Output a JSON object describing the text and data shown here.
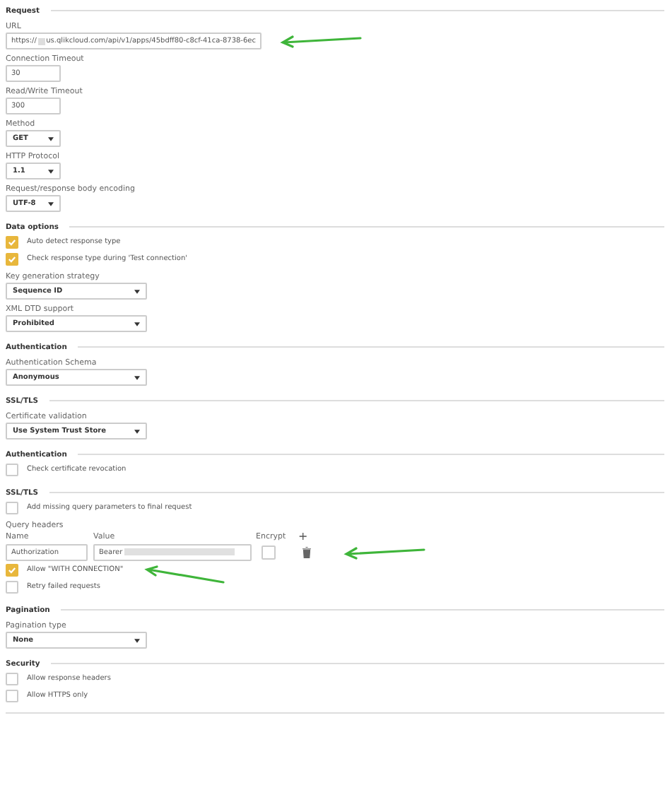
{
  "sections": [
    {
      "title": "Request",
      "items": [
        {
          "kind": "url-field",
          "label": "URL",
          "value_start": "https://",
          "value_end": "us.qlikcloud.com/api/v1/apps/45bdff80-c8cf-41ca-8738-6ec",
          "annotated": true
        },
        {
          "kind": "short-field",
          "label": "Connection Timeout",
          "value": "30"
        },
        {
          "kind": "short-field",
          "label": "Read/Write Timeout",
          "value": "300"
        },
        {
          "kind": "short-select",
          "label": "Method",
          "value": "GET"
        },
        {
          "kind": "short-select",
          "label": "HTTP Protocol",
          "value": "1.1"
        },
        {
          "kind": "short-select",
          "label": "Request/response body encoding",
          "value": "UTF-8"
        }
      ]
    },
    {
      "title": "Data options",
      "items": [
        {
          "kind": "checkbox",
          "label": "Auto detect response type",
          "checked": true
        },
        {
          "kind": "checkbox",
          "label": "Check response type during 'Test connection'",
          "checked": true
        },
        {
          "kind": "long-select",
          "label": "Key generation strategy",
          "value": "Sequence ID"
        },
        {
          "kind": "long-select",
          "label": "XML DTD support",
          "value": "Prohibited"
        }
      ]
    },
    {
      "title": "Authentication",
      "items": [
        {
          "kind": "long-select",
          "label": "Authentication Schema",
          "value": "Anonymous"
        }
      ]
    },
    {
      "title": "SSL/TLS",
      "items": [
        {
          "kind": "long-select",
          "label": "Certificate validation",
          "value": "Use System Trust Store"
        }
      ]
    },
    {
      "title": "Authentication",
      "items": [
        {
          "kind": "checkbox",
          "label": "Check certificate revocation",
          "checked": false
        }
      ]
    },
    {
      "title": "SSL/TLS",
      "items": [
        {
          "kind": "checkbox",
          "label": "Add missing query parameters to final request",
          "checked": false
        },
        {
          "kind": "headers",
          "label": "Query headers",
          "name_heading": "Name",
          "value_heading": "Value",
          "encrypt_heading": "Encrypt",
          "add_symbol": "+",
          "rows": [
            {
              "name": "Authorization",
              "value": "Bearer",
              "encrypted": false,
              "annotated": true
            }
          ]
        },
        {
          "kind": "checkbox",
          "label": "Allow \"WITH CONNECTION\"",
          "checked": true,
          "annotated": true
        },
        {
          "kind": "checkbox",
          "label": "Retry failed requests",
          "checked": false
        }
      ]
    },
    {
      "title": "Pagination",
      "items": [
        {
          "kind": "long-select",
          "label": "Pagination type",
          "value": "None"
        }
      ]
    },
    {
      "title": "Security",
      "items": [
        {
          "kind": "checkbox",
          "label": "Allow response headers",
          "checked": false
        },
        {
          "kind": "checkbox",
          "label": "Allow HTTPS only",
          "checked": false
        }
      ]
    }
  ]
}
